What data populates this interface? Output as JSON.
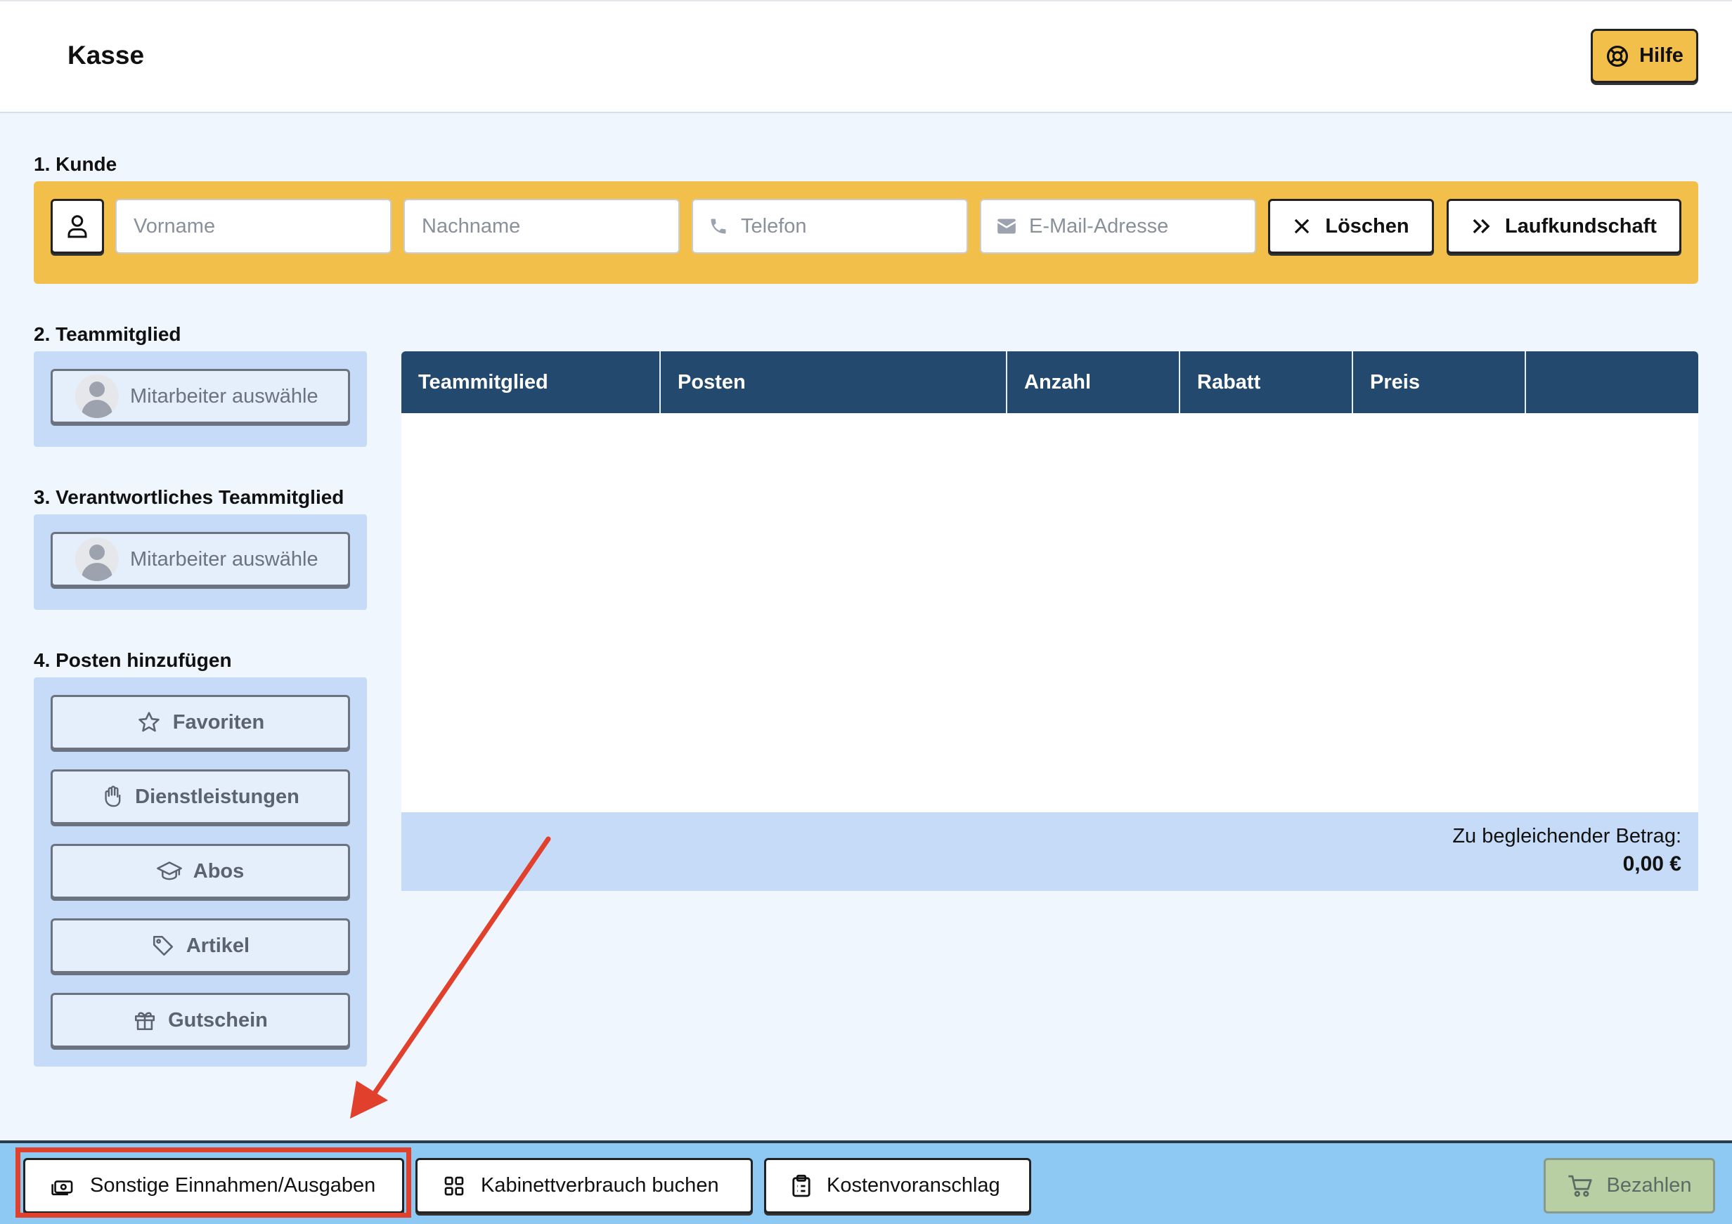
{
  "header": {
    "title": "Kasse",
    "help_label": "Hilfe"
  },
  "sections": {
    "kunde": "1. Kunde",
    "teammitglied": "2. Teammitglied",
    "verantwortlich": "3. Verantwortliches Teammitglied",
    "posten": "4. Posten hinzufügen"
  },
  "customer": {
    "first_name_placeholder": "Vorname",
    "last_name_placeholder": "Nachname",
    "phone_placeholder": "Telefon",
    "email_placeholder": "E-Mail-Adresse",
    "clear_label": "Löschen",
    "walkin_label": "Laufkundschaft"
  },
  "staff_select": {
    "placeholder": "Mitarbeiter auswähle"
  },
  "responsible_select": {
    "placeholder": "Mitarbeiter auswähle"
  },
  "add_items": [
    {
      "label": "Favoriten",
      "icon": "star-icon"
    },
    {
      "label": "Dienstleistungen",
      "icon": "hand-icon"
    },
    {
      "label": "Abos",
      "icon": "graduation-cap-icon"
    },
    {
      "label": "Artikel",
      "icon": "tag-icon"
    },
    {
      "label": "Gutschein",
      "icon": "gift-icon"
    }
  ],
  "table": {
    "columns": [
      "Teammitglied",
      "Posten",
      "Anzahl",
      "Rabatt",
      "Preis",
      ""
    ],
    "rows": []
  },
  "total": {
    "label": "Zu begleichender Betrag:",
    "amount": "0,00 €"
  },
  "footer": {
    "other_income_label": "Sonstige Einnahmen/Ausgaben",
    "cabinet_label": "Kabinettverbrauch buchen",
    "estimate_label": "Kostenvoranschlag",
    "pay_label": "Bezahlen"
  },
  "colors": {
    "accent_yellow": "#f2c04a",
    "table_header": "#234a6e",
    "panel_blue": "#c6dbf7",
    "footer_blue": "#8ec9f4",
    "annotation_red": "#e0402c"
  }
}
